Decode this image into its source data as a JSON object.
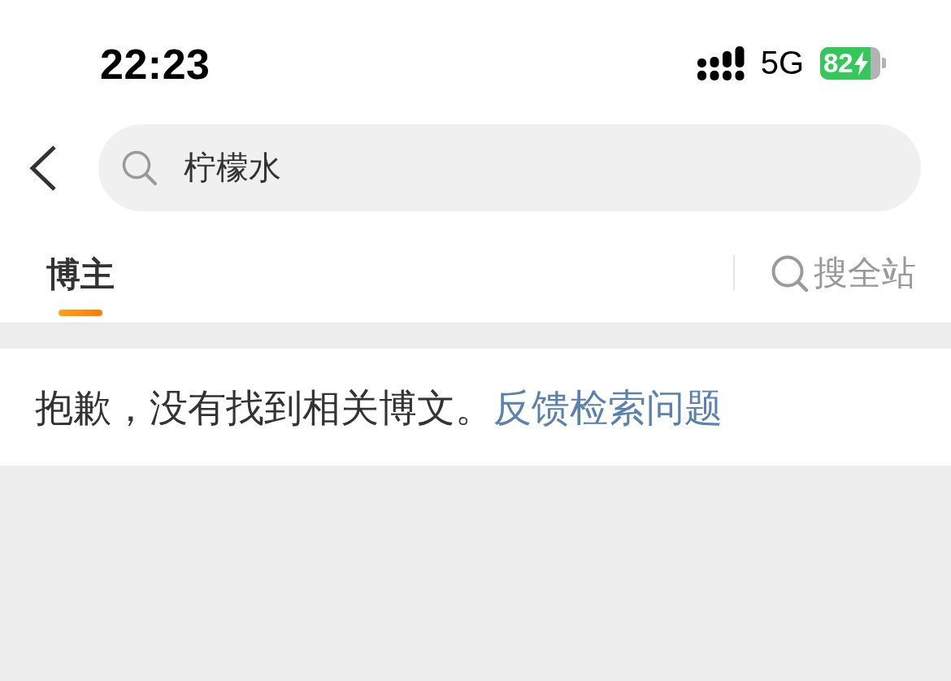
{
  "status_bar": {
    "time": "22:23",
    "network": "5G",
    "battery": "82",
    "charging": true
  },
  "search": {
    "value": "柠檬水"
  },
  "tabs": [
    {
      "label": "博主",
      "selected": true
    }
  ],
  "search_all": {
    "label": "搜全站"
  },
  "message": {
    "text": "抱歉，没有找到相关博文。",
    "link": "反馈检索问题"
  }
}
